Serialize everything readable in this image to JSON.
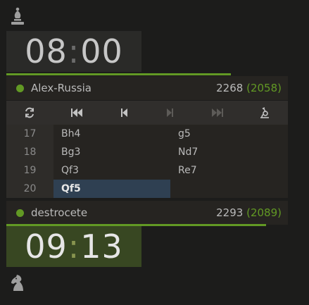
{
  "top": {
    "piece_icon": "bishop-icon",
    "clock": {
      "min": "08",
      "sep": ":",
      "sec": "00"
    },
    "player": {
      "name": "Alex-Russia",
      "rating": "2268",
      "provisional": "(2058)"
    }
  },
  "controls": [
    {
      "name": "flip-board-button",
      "icon": "flip-icon",
      "enabled": true
    },
    {
      "name": "first-move-button",
      "icon": "skip-back-icon",
      "enabled": true
    },
    {
      "name": "prev-move-button",
      "icon": "step-back-icon",
      "enabled": true
    },
    {
      "name": "next-move-button",
      "icon": "step-forward-icon",
      "enabled": false
    },
    {
      "name": "last-move-button",
      "icon": "skip-forward-icon",
      "enabled": false
    },
    {
      "name": "analysis-button",
      "icon": "microscope-icon",
      "enabled": true
    }
  ],
  "moves": [
    {
      "num": "17",
      "white": "Bh4",
      "black": "g5"
    },
    {
      "num": "18",
      "white": "Bg3",
      "black": "Nd7"
    },
    {
      "num": "19",
      "white": "Qf3",
      "black": "Re7"
    },
    {
      "num": "20",
      "white": "Qf5",
      "black": ""
    }
  ],
  "bottom": {
    "player": {
      "name": "destrocete",
      "rating": "2293",
      "provisional": "(2089)"
    },
    "clock": {
      "min": "09",
      "sep": ":",
      "sec": "13"
    },
    "piece_icon": "knight-icon"
  },
  "colors": {
    "accent": "#629924",
    "active_move": "#2f4052",
    "running_clock": "#384722"
  }
}
